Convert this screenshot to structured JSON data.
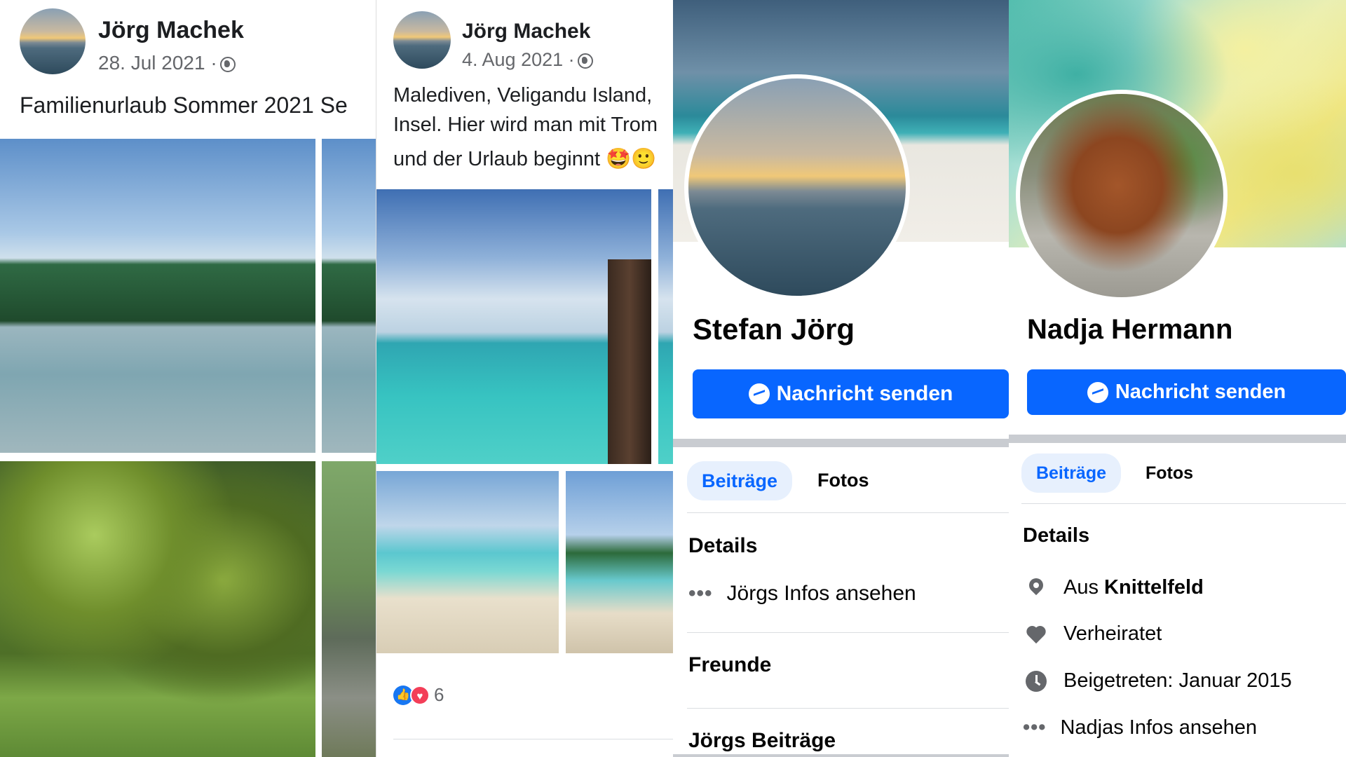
{
  "panel1": {
    "author": "Jörg Machek",
    "date": "28. Jul 2021 ·",
    "text": "Familienurlaub Sommer 2021 Se"
  },
  "panel2": {
    "author": "Jörg Machek",
    "date": "4. Aug 2021 ·",
    "text_lines": [
      "Malediven, Veligandu Island,",
      "Insel. Hier wird man mit Trom",
      "und der Urlaub beginnt 🤩🙂"
    ],
    "reaction_count": "6",
    "reaction_icons": [
      "like-icon",
      "love-icon"
    ]
  },
  "panel3": {
    "name": "Stefan Jörg",
    "message_button": "Nachricht senden",
    "tabs": [
      "Beiträge",
      "Fotos"
    ],
    "details_heading": "Details",
    "details_items": [
      {
        "icon": "dots-icon",
        "label": "Jörgs Infos ansehen"
      }
    ],
    "friends_heading": "Freunde",
    "posts_heading": "Jörgs Beiträge"
  },
  "panel4": {
    "name": "Nadja Hermann",
    "message_button": "Nachricht senden",
    "tabs": [
      "Beiträge",
      "Fotos"
    ],
    "details_heading": "Details",
    "details_items": [
      {
        "icon": "location-pin-icon",
        "prefix": "Aus ",
        "value": "Knittelfeld"
      },
      {
        "icon": "heart-icon",
        "label": "Verheiratet"
      },
      {
        "icon": "clock-icon",
        "label": "Beigetreten: Januar 2015"
      },
      {
        "icon": "dots-icon",
        "label": "Nadjas Infos ansehen"
      }
    ]
  },
  "colors": {
    "primary": "#0866ff",
    "tab_bg": "#e7f0fd",
    "muted": "#65676b",
    "separator": "#c9ccd1"
  }
}
